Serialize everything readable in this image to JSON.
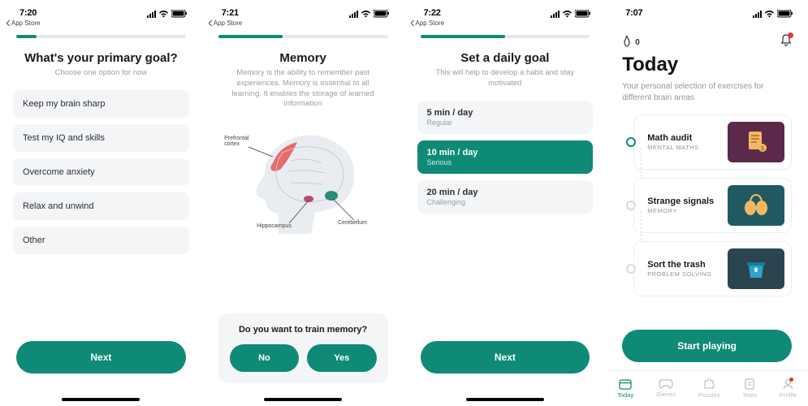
{
  "accent": "#0f8a76",
  "screen1": {
    "time": "7:20",
    "back_label": "App Store",
    "progress_pct": 12,
    "title": "What's your primary goal?",
    "subtitle": "Choose one option for now",
    "options": [
      "Keep my brain sharp",
      "Test my IQ and skills",
      "Overcome anxiety",
      "Relax and unwind",
      "Other"
    ],
    "cta": "Next"
  },
  "screen2": {
    "time": "7:21",
    "back_label": "App Store",
    "progress_pct": 38,
    "title": "Memory",
    "subtitle": "Memory is the ability to remember past experiences. Memory is essential to all learning. It enables the storage of learned information",
    "brain_labels": {
      "prefrontal": "Prefrontal cortex",
      "hippocampus": "Hippocampus",
      "cerebellum": "Cerebellum"
    },
    "question": "Do you want to train memory?",
    "no": "No",
    "yes": "Yes"
  },
  "screen3": {
    "time": "7:22",
    "back_label": "App Store",
    "progress_pct": 50,
    "title": "Set a daily goal",
    "subtitle": "This will help to develop a habit and stay motivated",
    "goals": [
      {
        "title": "5 min / day",
        "sub": "Regular",
        "selected": false
      },
      {
        "title": "10 min / day",
        "sub": "Serious",
        "selected": true
      },
      {
        "title": "20 min / day",
        "sub": "Challenging",
        "selected": false
      }
    ],
    "cta": "Next"
  },
  "screen4": {
    "time": "7:07",
    "streak": "0",
    "title": "Today",
    "subtitle": "Your personal selection of exercises for different brain areas",
    "exercises": [
      {
        "name": "Math audit",
        "cat": "MENTAL MATHS",
        "bg": "#5b2a4a",
        "icon": "clipboard"
      },
      {
        "name": "Strange signals",
        "cat": "MEMORY",
        "bg": "#1f5a63",
        "icon": "bulbs"
      },
      {
        "name": "Sort the trash",
        "cat": "PROBLEM SOLVING",
        "bg": "#2a4550",
        "icon": "recycle"
      }
    ],
    "cta": "Start playing",
    "tabs": [
      {
        "label": "Today",
        "active": true,
        "icon": "calendar"
      },
      {
        "label": "Games",
        "active": false,
        "icon": "gamepad"
      },
      {
        "label": "Puzzles",
        "active": false,
        "icon": "puzzle"
      },
      {
        "label": "Tests",
        "active": false,
        "icon": "tests"
      },
      {
        "label": "Profile",
        "active": false,
        "icon": "profile",
        "badge": true
      }
    ]
  }
}
